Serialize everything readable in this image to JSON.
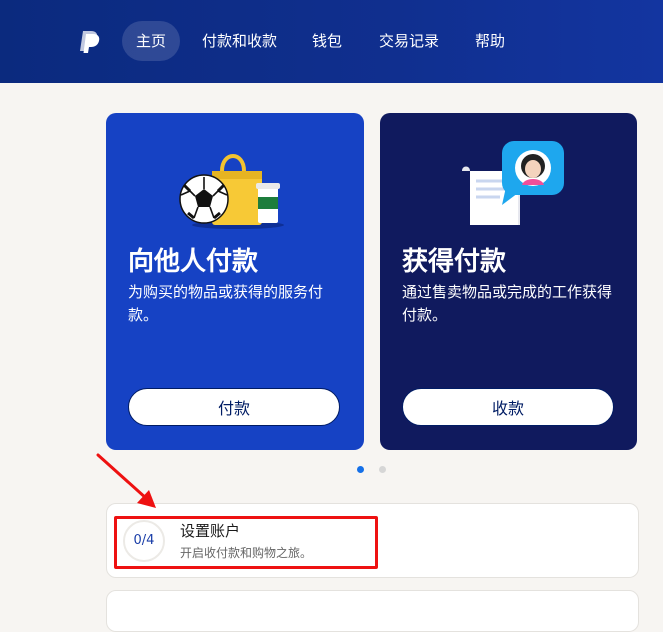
{
  "nav": {
    "items": [
      {
        "label": "主页",
        "active": true
      },
      {
        "label": "付款和收款"
      },
      {
        "label": "钱包"
      },
      {
        "label": "交易记录"
      },
      {
        "label": "帮助"
      }
    ],
    "logo_icon": "paypal-logo-icon"
  },
  "cards": [
    {
      "title": "向他人付款",
      "description": "为购买的物品或获得的服务付款。",
      "button": "付款",
      "color": "#1642c4"
    },
    {
      "title": "获得付款",
      "description": "通过售卖物品或完成的工作获得付款。",
      "button": "收款",
      "color": "#101a5e"
    }
  ],
  "carousel": {
    "count": 2,
    "active": 0
  },
  "setup": {
    "progress": "0/4",
    "title": "设置账户",
    "subtitle": "开启收付款和购物之旅。"
  },
  "colors": {
    "topbar": "#0b2a7e",
    "accent": "#1570e8",
    "highlight": "#ee1111"
  }
}
